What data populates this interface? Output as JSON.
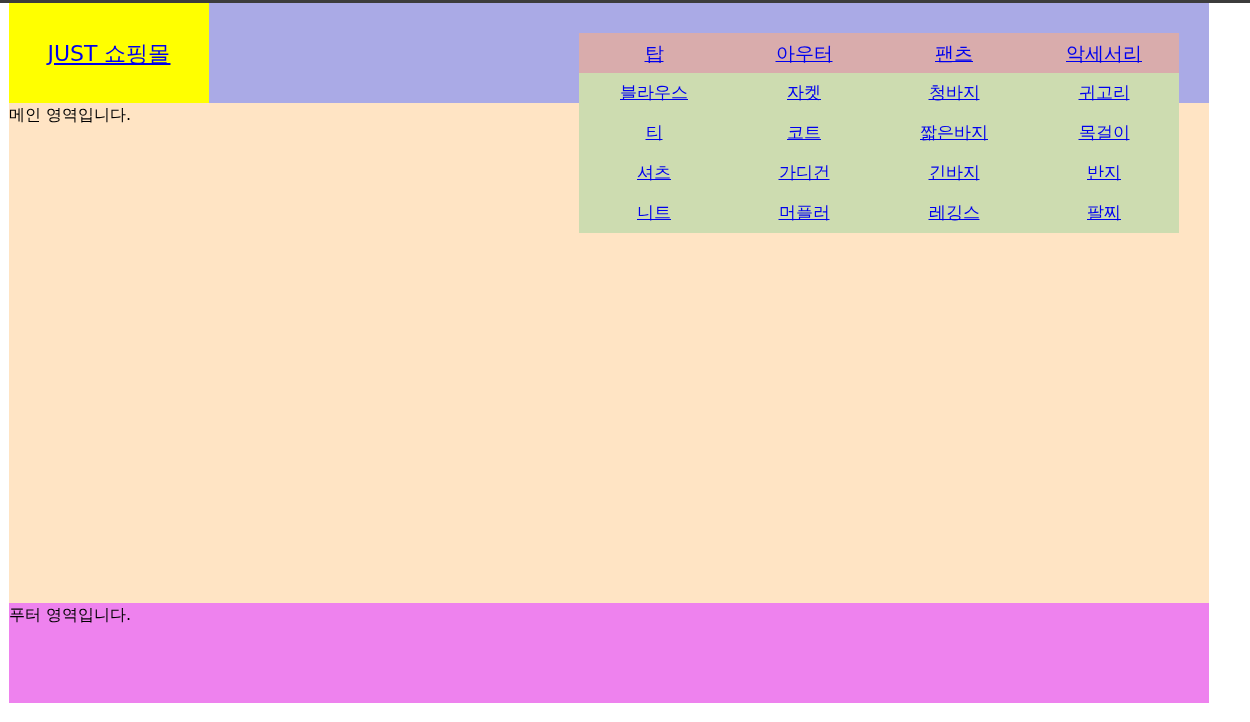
{
  "header": {
    "logo": "JUST 쇼핑몰",
    "menu": [
      {
        "label": "탑",
        "items": [
          "블라우스",
          "티",
          "셔츠",
          "니트"
        ]
      },
      {
        "label": "아우터",
        "items": [
          "자켓",
          "코트",
          "가디건",
          "머플러"
        ]
      },
      {
        "label": "팬츠",
        "items": [
          "청바지",
          "짧은바지",
          "긴바지",
          "레깅스"
        ]
      },
      {
        "label": "악세서리",
        "items": [
          "귀고리",
          "목걸이",
          "반지",
          "팔찌"
        ]
      }
    ]
  },
  "main": {
    "text": "메인 영역입니다."
  },
  "footer": {
    "text": "푸터 영역입니다."
  }
}
